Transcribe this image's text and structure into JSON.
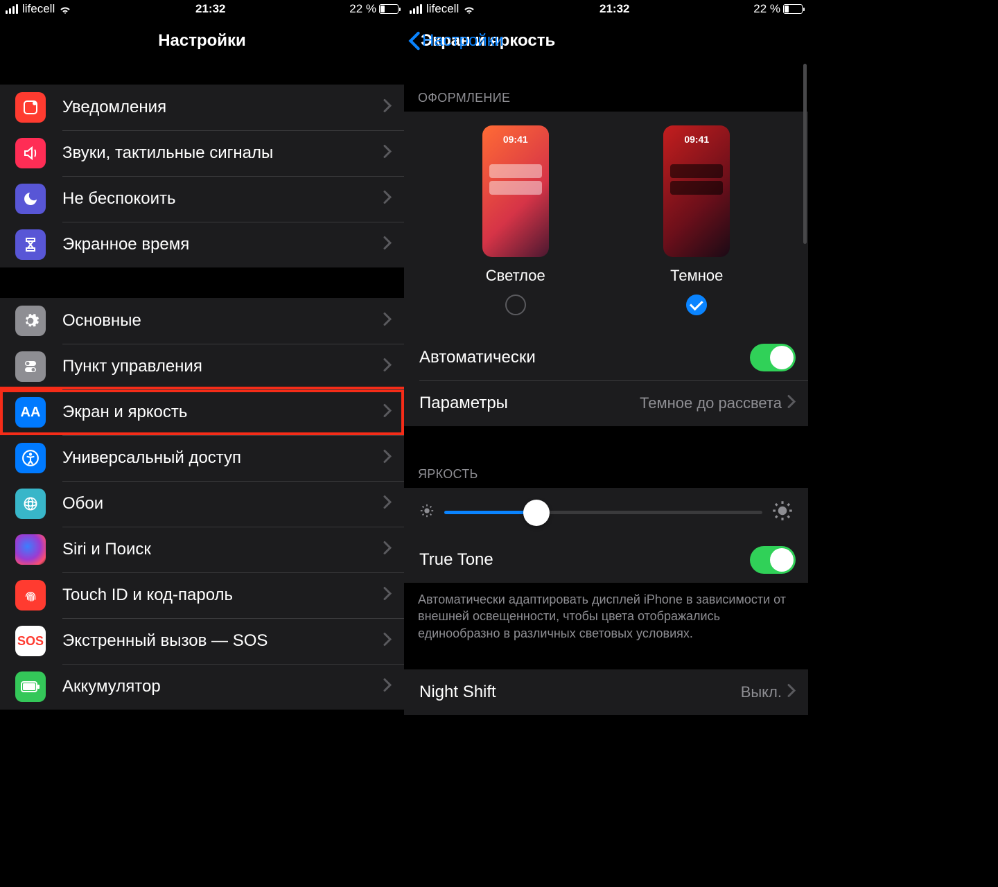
{
  "status": {
    "carrier": "lifecell",
    "time": "21:32",
    "battery_pct": "22 %"
  },
  "left": {
    "title": "Настройки",
    "items": [
      {
        "label": "Уведомления",
        "icon": "notifications",
        "color": "#ff3b30"
      },
      {
        "label": "Звуки, тактильные сигналы",
        "icon": "sounds",
        "color": "#ff2d55"
      },
      {
        "label": "Не беспокоить",
        "icon": "dnd",
        "color": "#5856d6"
      },
      {
        "label": "Экранное время",
        "icon": "screentime",
        "color": "#5856d6"
      }
    ],
    "items2": [
      {
        "label": "Основные",
        "icon": "general",
        "color": "#8e8e93"
      },
      {
        "label": "Пункт управления",
        "icon": "control",
        "color": "#8e8e93"
      },
      {
        "label": "Экран и яркость",
        "icon": "display",
        "color": "#007aff",
        "hl": true
      },
      {
        "label": "Универсальный доступ",
        "icon": "accessibility",
        "color": "#007aff"
      },
      {
        "label": "Обои",
        "icon": "wallpaper",
        "color": "#38b6c9"
      },
      {
        "label": "Siri и Поиск",
        "icon": "siri",
        "color": "#1c1c1e"
      },
      {
        "label": "Touch ID и код-пароль",
        "icon": "touchid",
        "color": "#ff3b30"
      },
      {
        "label": "Экстренный вызов — SOS",
        "icon": "sos",
        "color": "#ffffff"
      },
      {
        "label": "Аккумулятор",
        "icon": "battery",
        "color": "#34c759"
      }
    ]
  },
  "right": {
    "back": "Настройки",
    "title": "Экран и яркость",
    "appearance_header": "ОФОРМЛЕНИЕ",
    "preview_time": "09:41",
    "light_label": "Светлое",
    "dark_label": "Темное",
    "auto_label": "Автоматически",
    "params_label": "Параметры",
    "params_value": "Темное до рассвета",
    "brightness_header": "ЯРКОСТЬ",
    "truetone_label": "True Tone",
    "truetone_note": "Автоматически адаптировать дисплей iPhone в зависимости от внешней освещенности, чтобы цвета отображались единообразно в различных световых условиях.",
    "nightshift_label": "Night Shift",
    "nightshift_value": "Выкл."
  }
}
